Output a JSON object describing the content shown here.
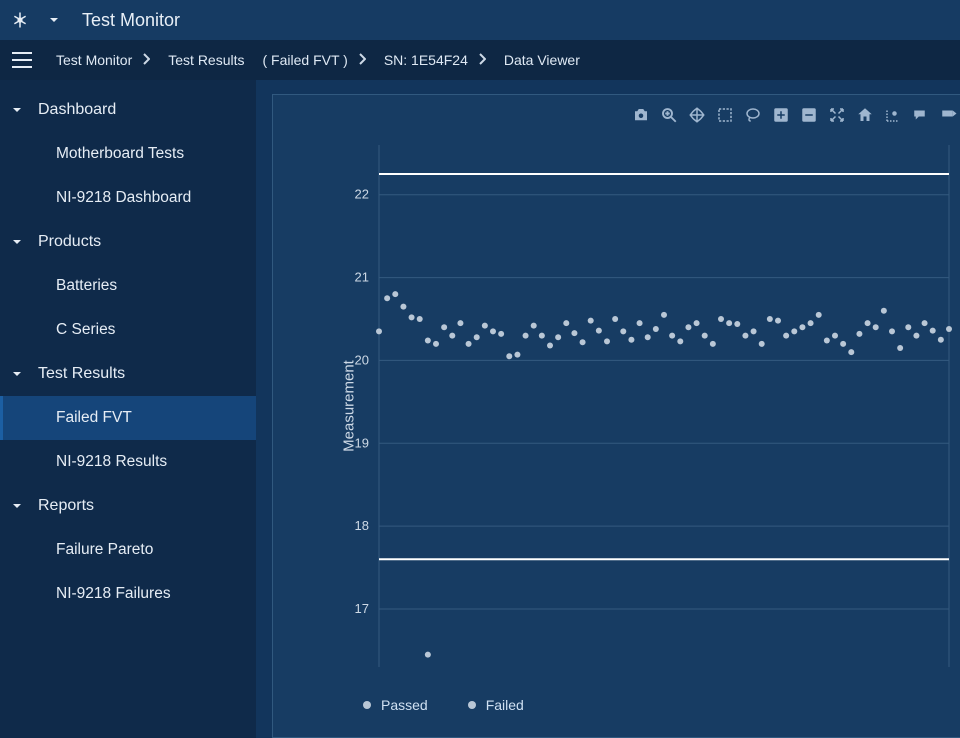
{
  "titlebar": {
    "title": "Test Monitor"
  },
  "breadcrumbs": [
    {
      "label": "Test Monitor",
      "chev": true
    },
    {
      "label": "Test Results",
      "chev": false
    },
    {
      "label": "( Failed FVT )",
      "chev": true
    },
    {
      "label": "SN: 1E54F24",
      "chev": true
    },
    {
      "label": "Data Viewer",
      "chev": false
    }
  ],
  "sidebar": {
    "groups": [
      {
        "label": "Dashboard",
        "expanded": true,
        "items": [
          {
            "label": "Motherboard Tests",
            "active": false
          },
          {
            "label": "NI-9218 Dashboard",
            "active": false
          }
        ]
      },
      {
        "label": "Products",
        "expanded": true,
        "items": [
          {
            "label": "Batteries",
            "active": false
          },
          {
            "label": "C Series",
            "active": false
          }
        ]
      },
      {
        "label": "Test Results",
        "expanded": true,
        "items": [
          {
            "label": "Failed FVT",
            "active": true
          },
          {
            "label": "NI-9218 Results",
            "active": false
          }
        ]
      },
      {
        "label": "Reports",
        "expanded": true,
        "items": [
          {
            "label": "Failure Pareto",
            "active": false
          },
          {
            "label": "NI-9218 Failures",
            "active": false
          }
        ]
      }
    ]
  },
  "chart_data": {
    "type": "scatter",
    "ylabel": "Measurement",
    "xlabel": "",
    "ylim": [
      16.3,
      22.6
    ],
    "yticks": [
      17,
      18,
      19,
      20,
      21,
      22
    ],
    "upper_limit": 22.25,
    "lower_limit": 17.6,
    "legend": [
      "Passed",
      "Failed"
    ],
    "series": [
      {
        "name": "Passed",
        "values": [
          20.35,
          20.75,
          20.8,
          20.65,
          20.52,
          20.5,
          20.24,
          20.2,
          20.4,
          20.3,
          20.45,
          20.2,
          20.28,
          20.42,
          20.35,
          20.32,
          20.05,
          20.07,
          20.3,
          20.42,
          20.3,
          20.18,
          20.28,
          20.45,
          20.33,
          20.22,
          20.48,
          20.36,
          20.23,
          20.5,
          20.35,
          20.25,
          20.45,
          20.28,
          20.38,
          20.55,
          20.3,
          20.23,
          20.4,
          20.45,
          20.3,
          20.2,
          20.5,
          20.45,
          20.44,
          20.3,
          20.35,
          20.2,
          20.5,
          20.48,
          20.3,
          20.35,
          20.4,
          20.45,
          20.55,
          20.24,
          20.3,
          20.2,
          20.1,
          20.32,
          20.45,
          20.4,
          20.6,
          20.35,
          20.15,
          20.4,
          20.3,
          20.45,
          20.36,
          20.25,
          20.38
        ]
      },
      {
        "name": "Failed",
        "values": [
          null,
          null,
          null,
          null,
          null,
          null,
          16.45
        ]
      }
    ]
  },
  "toolbar_icons": [
    "camera",
    "zoom",
    "pan",
    "box-select",
    "lasso",
    "zoom-in",
    "zoom-out",
    "autoscale",
    "reset",
    "spike",
    "hover",
    "tag"
  ]
}
